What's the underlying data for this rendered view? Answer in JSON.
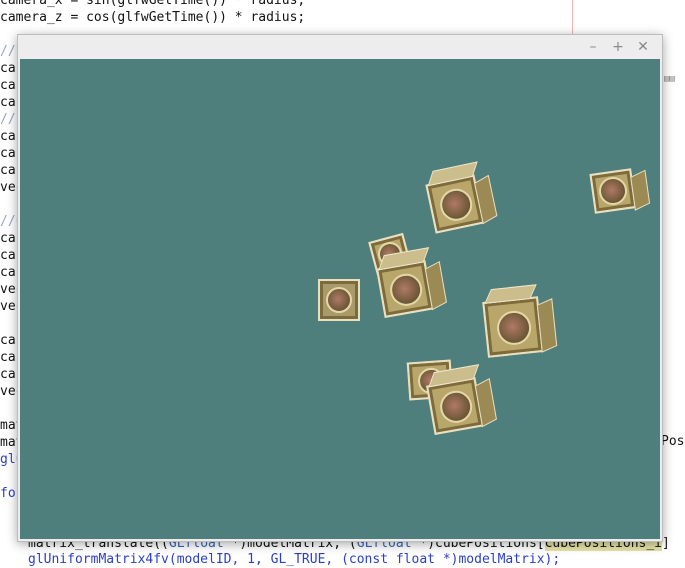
{
  "editor": {
    "lines": [
      {
        "text": "camera_x = sin(glfwGetTime()) * radius;",
        "style": "plain"
      },
      {
        "text": "camera_z = cos(glfwGetTime()) * radius;",
        "style": "plain"
      },
      {
        "text": "//",
        "style": "comment"
      },
      {
        "text": "car",
        "style": "plain"
      },
      {
        "text": "car",
        "style": "plain"
      },
      {
        "text": "car",
        "style": "plain"
      },
      {
        "text": "//c",
        "style": "comment"
      },
      {
        "text": "car",
        "style": "plain"
      },
      {
        "text": "car",
        "style": "plain"
      },
      {
        "text": "car",
        "style": "plain"
      },
      {
        "text": "vec",
        "style": "plain"
      },
      {
        "text": "//u",
        "style": "comment"
      },
      {
        "text": "car",
        "style": "plain"
      },
      {
        "text": "car",
        "style": "plain"
      },
      {
        "text": "car",
        "style": "plain"
      },
      {
        "text": "vec",
        "style": "plain"
      },
      {
        "text": "vec",
        "style": "plain"
      },
      {
        "text": "car",
        "style": "plain"
      },
      {
        "text": "car",
        "style": "plain"
      },
      {
        "text": "car",
        "style": "plain"
      },
      {
        "text": "vec",
        "style": "plain"
      },
      {
        "text": "mat",
        "style": "plain"
      },
      {
        "text": "mat",
        "style": "plain"
      },
      {
        "text": "glu",
        "style": "kw"
      },
      {
        "text": "for",
        "style": "kw"
      }
    ],
    "right_label": "Pos",
    "bottom_line_1": {
      "p1": "matrix_translate((",
      "p2": "GLfloat",
      "p3": " *)modelMatrix, (",
      "p4": "GLfloat",
      "p5": " *)cubePositions[",
      "p6": "cubePositions_i",
      "p7": "]"
    },
    "bottom_line_2": "glUniformMatrix4fv(modelID, 1, GL_TRUE, (const float *)modelMatrix);"
  },
  "window": {
    "minimize": "–",
    "maximize": "+",
    "close": "✕",
    "clear_color": "#4f7f7c",
    "cubes": [
      {
        "name": "cube-1"
      },
      {
        "name": "cube-2"
      },
      {
        "name": "cube-3"
      },
      {
        "name": "cube-4"
      },
      {
        "name": "cube-5"
      },
      {
        "name": "cube-6"
      },
      {
        "name": "cube-7"
      },
      {
        "name": "cube-8"
      }
    ]
  }
}
